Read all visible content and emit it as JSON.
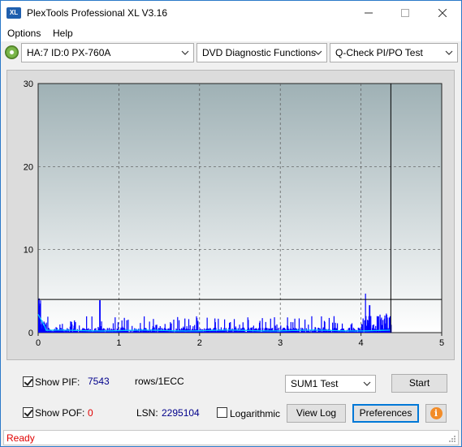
{
  "window": {
    "title": "PlexTools Professional XL V3.16",
    "app_icon_text": "XL"
  },
  "menu": {
    "items": [
      "Options",
      "Help"
    ]
  },
  "toolbar": {
    "drive": "HA:7 ID:0  PX-760A",
    "function": "DVD Diagnostic Functions",
    "test": "Q-Check PI/PO Test"
  },
  "chart_data": {
    "type": "bar",
    "xlim": [
      0,
      5
    ],
    "ylim": [
      0,
      30
    ],
    "x_ticks": [
      "0",
      "1",
      "2",
      "3",
      "4",
      "5"
    ],
    "y_ticks": [
      "0",
      "10",
      "20",
      "30"
    ],
    "grid": true,
    "end_marker_x": 4.37,
    "threshold_y": 4,
    "colors": {
      "bars": "#0000ff",
      "line": "#00c8ff",
      "plot_bg_top": "#9fb1b5",
      "plot_bg_bottom": "#ffffff"
    }
  },
  "controls": {
    "show_pif_label": "Show PIF:",
    "pif_value": "7543",
    "rows_label": "rows/1ECC",
    "show_pof_label": "Show POF:",
    "pof_value": "0",
    "lsn_label": "LSN:",
    "lsn_value": "2295104",
    "logarithmic_label": "Logarithmic",
    "sum_select": "SUM1 Test",
    "start_label": "Start",
    "view_log_label": "View Log",
    "preferences_label": "Preferences"
  },
  "status": {
    "text": "Ready"
  }
}
